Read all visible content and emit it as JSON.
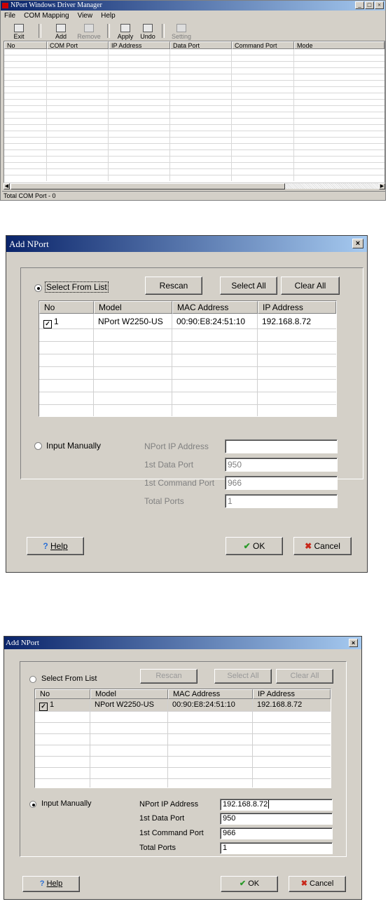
{
  "manager": {
    "title": "NPort Windows Driver Manager",
    "window_buttons": [
      "_",
      "□",
      "×"
    ],
    "menu": [
      "File",
      "COM Mapping",
      "View",
      "Help"
    ],
    "toolbar": {
      "exit": "Exit",
      "add": "Add",
      "remove": "Remove",
      "apply": "Apply",
      "undo": "Undo",
      "setting": "Setting"
    },
    "columns": [
      "No",
      "COM Port",
      "IP Address",
      "Data Port",
      "Command Port",
      "Mode"
    ],
    "status": "Total COM Port - 0"
  },
  "dialog1": {
    "title": "Add NPort",
    "close": "×",
    "select_from_list": "Select From List",
    "select_from_list_checked": true,
    "rescan": "Rescan",
    "select_all": "Select All",
    "clear_all": "Clear All",
    "columns": [
      "No",
      "Model",
      "MAC Address",
      "IP Address"
    ],
    "rows": [
      {
        "no": "1",
        "checked": true,
        "model": "NPort W2250-US",
        "mac": "00:90:E8:24:51:10",
        "ip": "192.168.8.72"
      }
    ],
    "input_manually": "Input Manually",
    "input_manually_checked": false,
    "fields": {
      "ip_label": "NPort IP Address",
      "ip_value": "",
      "data_port_label": "1st Data Port",
      "data_port_value": "950",
      "command_port_label": "1st Command Port",
      "command_port_value": "966",
      "total_ports_label": "Total Ports",
      "total_ports_value": "1"
    },
    "help": "Help",
    "ok": "OK",
    "cancel": "Cancel"
  },
  "dialog2": {
    "title": "Add NPort",
    "close": "×",
    "select_from_list": "Select From List",
    "select_from_list_checked": false,
    "rescan": "Rescan",
    "select_all": "Select All",
    "clear_all": "Clear All",
    "columns": [
      "No",
      "Model",
      "MAC Address",
      "IP Address"
    ],
    "rows": [
      {
        "no": "1",
        "checked": true,
        "model": "NPort W2250-US",
        "mac": "00:90:E8:24:51:10",
        "ip": "192.168.8.72"
      }
    ],
    "input_manually": "Input Manually",
    "input_manually_checked": true,
    "fields": {
      "ip_label": "NPort IP Address",
      "ip_value": "192.168.8.72",
      "data_port_label": "1st Data Port",
      "data_port_value": "950",
      "command_port_label": "1st Command Port",
      "command_port_value": "966",
      "total_ports_label": "Total Ports",
      "total_ports_value": "1"
    },
    "help": "Help",
    "ok": "OK",
    "cancel": "Cancel"
  },
  "icons": {
    "help": "question-mark",
    "ok": "check-mark",
    "cancel": "x-mark",
    "check": "✓"
  }
}
